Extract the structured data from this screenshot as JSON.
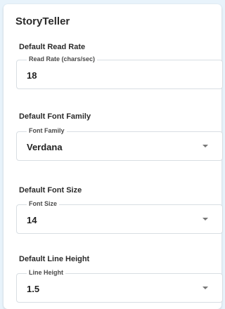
{
  "app": {
    "title": "StoryTeller"
  },
  "settings": [
    {
      "section_title": "Default Read Rate",
      "field_label": "Read Rate (chars/sec)",
      "value": "18",
      "type": "number"
    },
    {
      "section_title": "Default Font Family",
      "field_label": "Font Family",
      "value": "Verdana",
      "type": "select"
    },
    {
      "section_title": "Default Font Size",
      "field_label": "Font Size",
      "value": "14",
      "type": "select"
    },
    {
      "section_title": "Default Line Height",
      "field_label": "Line Height",
      "value": "1.5",
      "type": "select"
    }
  ],
  "colors": {
    "background": "#e8f3fb",
    "card": "#ffffff",
    "border": "#d8dee3",
    "text": "#222222"
  },
  "icons": {
    "dropdown": "chevron-down-icon"
  }
}
